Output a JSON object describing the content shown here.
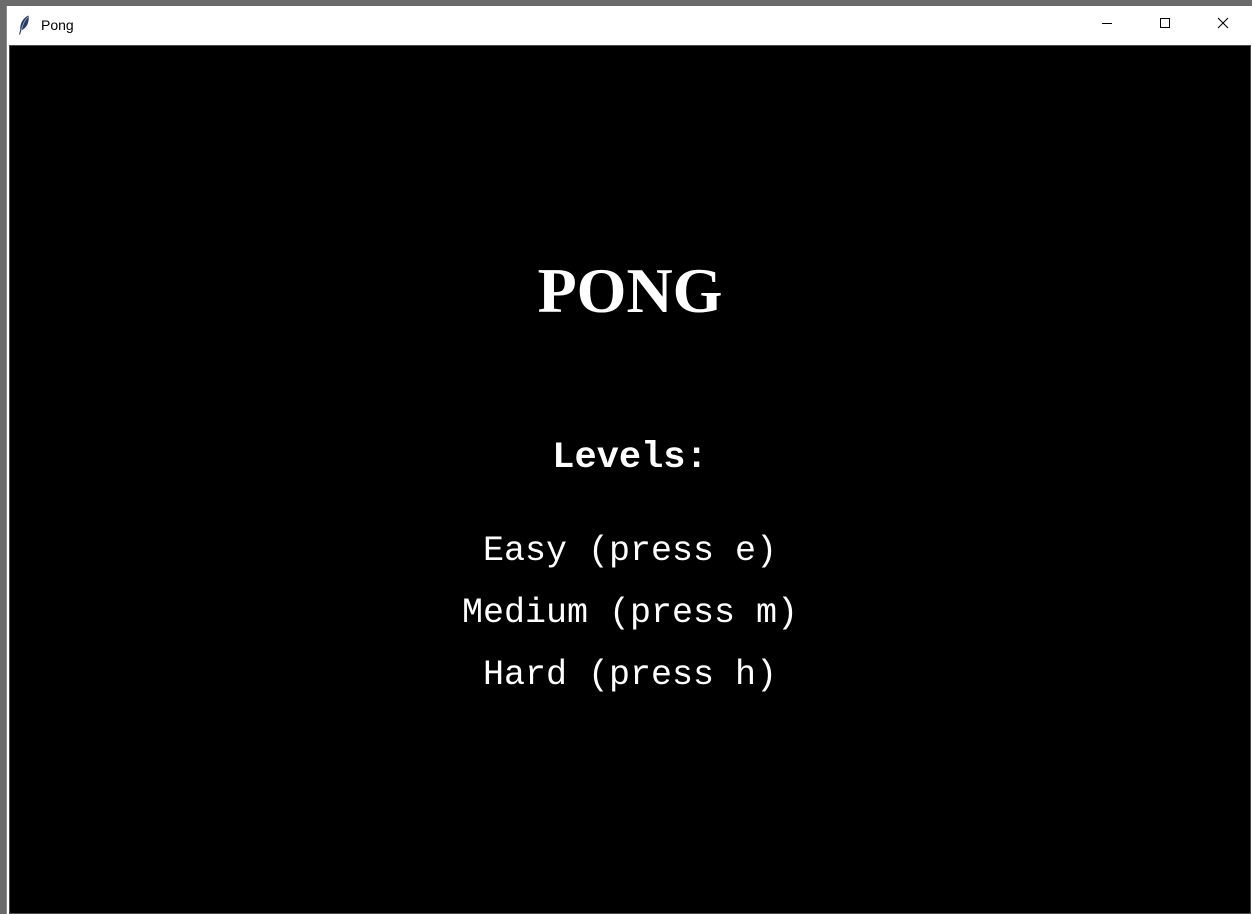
{
  "window": {
    "title": "Pong",
    "icon": "feather-icon",
    "controls": {
      "minimize": "minimize-icon",
      "maximize": "maximize-icon",
      "close": "close-icon"
    }
  },
  "game": {
    "title": "PONG",
    "levels_heading": "Levels:",
    "levels": [
      {
        "label": "Easy (press e)"
      },
      {
        "label": "Medium (press m)"
      },
      {
        "label": "Hard (press h)"
      }
    ]
  },
  "colors": {
    "background": "#000000",
    "text": "#ffffff"
  }
}
